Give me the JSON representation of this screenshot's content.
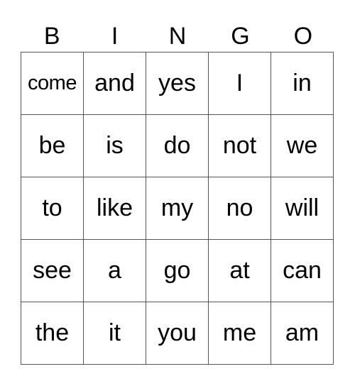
{
  "header": [
    "B",
    "I",
    "N",
    "G",
    "O"
  ],
  "cells": [
    [
      "come",
      "and",
      "yes",
      "I",
      "in"
    ],
    [
      "be",
      "is",
      "do",
      "not",
      "we"
    ],
    [
      "to",
      "like",
      "my",
      "no",
      "will"
    ],
    [
      "see",
      "a",
      "go",
      "at",
      "can"
    ],
    [
      "the",
      "it",
      "you",
      "me",
      "am"
    ]
  ]
}
